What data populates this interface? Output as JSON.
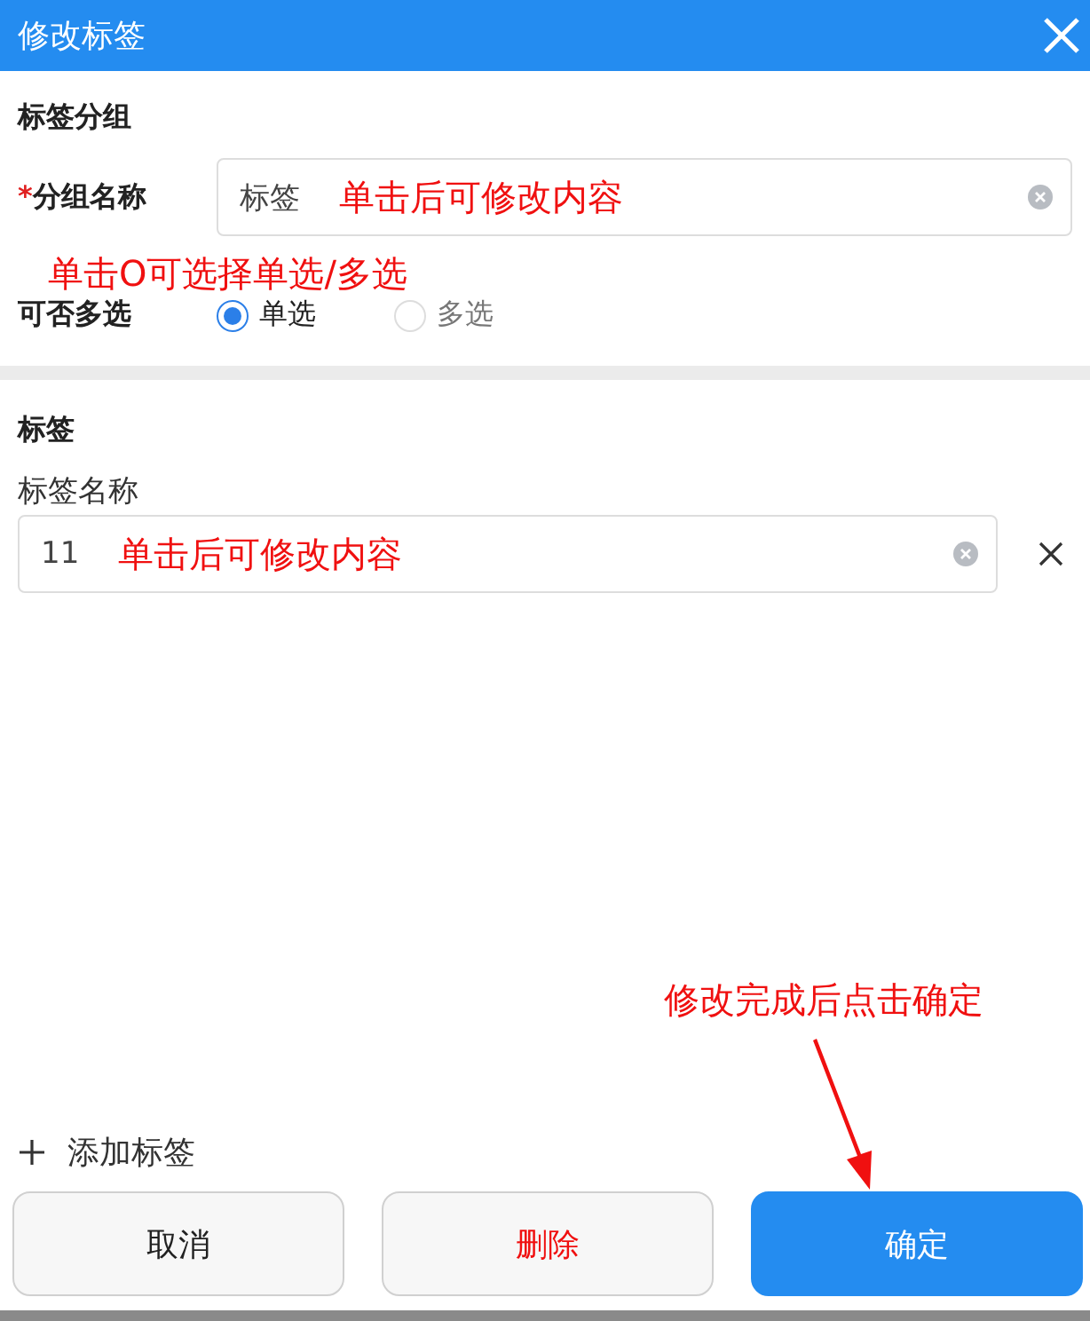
{
  "window": {
    "title": "修改标签"
  },
  "group_section": {
    "title": "标签分组",
    "name_field": {
      "required_mark": "*",
      "label": "分组名称",
      "value": "标签",
      "annotation": "单击后可修改内容"
    },
    "annotation": "单击O可选择单选/多选",
    "multi_select": {
      "label": "可否多选",
      "options": [
        {
          "label": "单选",
          "selected": true
        },
        {
          "label": "多选",
          "selected": false
        }
      ]
    }
  },
  "tag_section": {
    "title": "标签",
    "tags": [
      {
        "label": "标签名称",
        "value": "11",
        "annotation": "单击后可修改内容"
      }
    ],
    "add_button": "添加标签"
  },
  "annotation": "修改完成后点击确定",
  "buttons": [
    {
      "label": "取消",
      "kind": "default"
    },
    {
      "label": "删除",
      "kind": "danger"
    },
    {
      "label": "确定",
      "kind": "primary"
    }
  ]
}
